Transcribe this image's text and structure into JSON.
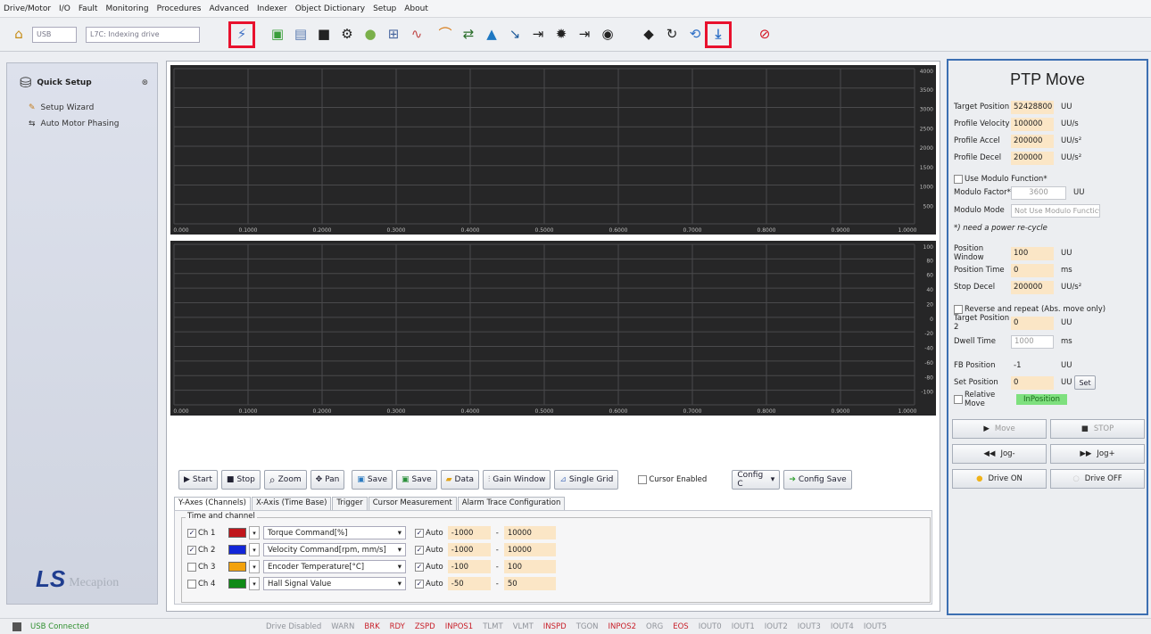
{
  "menu": [
    "Drive/Motor",
    "I/O",
    "Fault",
    "Monitoring",
    "Procedures",
    "Advanced",
    "Indexer",
    "Object Dictionary",
    "Setup",
    "About"
  ],
  "toolbar": {
    "connection": "USB",
    "drive": "L7C: Indexing drive"
  },
  "sidebar": {
    "title": "Quick Setup",
    "items": [
      "Setup Wizard",
      "Auto Motor Phasing"
    ],
    "logo_ls": "LS",
    "logo_text": "Mecapion"
  },
  "scope1": {
    "yticks": [
      "4000",
      "3500",
      "3000",
      "2500",
      "2000",
      "1500",
      "1000",
      "500"
    ],
    "xticks": [
      "0.000",
      "0.1000",
      "0.2000",
      "0.3000",
      "0.4000",
      "0.5000",
      "0.6000",
      "0.7000",
      "0.8000",
      "0.9000",
      "1.0000"
    ]
  },
  "scope2": {
    "yticks": [
      "100",
      "80",
      "60",
      "40",
      "20",
      "0",
      "-20",
      "-40",
      "-60",
      "-80",
      "-100"
    ],
    "xticks": [
      "0.000",
      "0.1000",
      "0.2000",
      "0.3000",
      "0.4000",
      "0.5000",
      "0.6000",
      "0.7000",
      "0.8000",
      "0.9000",
      "1.0000"
    ]
  },
  "buttons": {
    "start": "Start",
    "stop": "Stop",
    "zoom": "Zoom",
    "pan": "Pan",
    "save1": "Save",
    "save2": "Save",
    "data": "Data",
    "gain": "Gain Window",
    "single": "Single Grid",
    "cursor": "Cursor Enabled",
    "config": "Config C",
    "config_save": "Config Save"
  },
  "tabs": [
    "Y-Axes (Channels)",
    "X-Axis (Time Base)",
    "Trigger",
    "Cursor Measurement",
    "Alarm Trace Configuration"
  ],
  "group_title": "Time and channel",
  "auto_label": "Auto",
  "channels": [
    {
      "name": "Ch 1",
      "checked": "✓",
      "color": "#c0161c",
      "signal": "Torque Command[%]",
      "min": "-1000",
      "max": "10000"
    },
    {
      "name": "Ch 2",
      "checked": "✓",
      "color": "#1226d8",
      "signal": "Velocity Command[rpm, mm/s]",
      "min": "-1000",
      "max": "10000"
    },
    {
      "name": "Ch 3",
      "checked": "",
      "color": "#f3a20c",
      "signal": "Encoder Temperature[°C]",
      "min": "-100",
      "max": "100"
    },
    {
      "name": "Ch 4",
      "checked": "",
      "color": "#0f8a16",
      "signal": "Hall Signal Value",
      "min": "-50",
      "max": "50"
    }
  ],
  "ptp": {
    "title": "PTP Move",
    "target_position": {
      "label": "Target Position",
      "value": "52428800",
      "unit": "UU"
    },
    "profile_velocity": {
      "label": "Profile Velocity",
      "value": "100000",
      "unit": "UU/s"
    },
    "profile_accel": {
      "label": "Profile Accel",
      "value": "200000",
      "unit": "UU/s²"
    },
    "profile_decel": {
      "label": "Profile Decel",
      "value": "200000",
      "unit": "UU/s²"
    },
    "use_modulo": "Use Modulo Function*",
    "modulo_factor": {
      "label": "Modulo Factor*",
      "value": "3600",
      "unit": "UU"
    },
    "modulo_mode": {
      "label": "Modulo Mode",
      "value": "Not Use Modulo Functic"
    },
    "note": "*) need a power re-cycle",
    "position_window": {
      "label": "Position Window",
      "value": "100",
      "unit": "UU"
    },
    "position_time": {
      "label": "Position Time",
      "value": "0",
      "unit": "ms"
    },
    "stop_decel": {
      "label": "Stop Decel",
      "value": "200000",
      "unit": "UU/s²"
    },
    "reverse": "Reverse and repeat (Abs. move only)",
    "target_position2": {
      "label": "Target Position 2",
      "value": "0",
      "unit": "UU"
    },
    "dwell_time": {
      "label": "Dwell Time",
      "value": "1000",
      "unit": "ms"
    },
    "fb_position": {
      "label": "FB Position",
      "value": "-1",
      "unit": "UU"
    },
    "set_position": {
      "label": "Set Position",
      "value": "0",
      "unit": "UU",
      "button": "Set"
    },
    "relative": "Relative Move",
    "inposition": "InPosition",
    "move": "Move",
    "stop": "STOP",
    "jog_minus": "Jog-",
    "jog_plus": "Jog+",
    "drive_on": "Drive ON",
    "drive_off": "Drive OFF"
  },
  "status": {
    "connection": "USB Connected",
    "flags": [
      {
        "text": "Drive Disabled",
        "color": "grey"
      },
      {
        "text": "WARN",
        "color": "grey"
      },
      {
        "text": "BRK",
        "color": "red"
      },
      {
        "text": "RDY",
        "color": "red"
      },
      {
        "text": "ZSPD",
        "color": "red"
      },
      {
        "text": "INPOS1",
        "color": "red"
      },
      {
        "text": "TLMT",
        "color": "grey"
      },
      {
        "text": "VLMT",
        "color": "grey"
      },
      {
        "text": "INSPD",
        "color": "red"
      },
      {
        "text": "TGON",
        "color": "grey"
      },
      {
        "text": "INPOS2",
        "color": "red"
      },
      {
        "text": "ORG",
        "color": "grey"
      },
      {
        "text": "EOS",
        "color": "red"
      },
      {
        "text": "IOUT0",
        "color": "grey"
      },
      {
        "text": "IOUT1",
        "color": "grey"
      },
      {
        "text": "IOUT2",
        "color": "grey"
      },
      {
        "text": "IOUT3",
        "color": "grey"
      },
      {
        "text": "IOUT4",
        "color": "grey"
      },
      {
        "text": "IOUT5",
        "color": "grey"
      }
    ]
  }
}
